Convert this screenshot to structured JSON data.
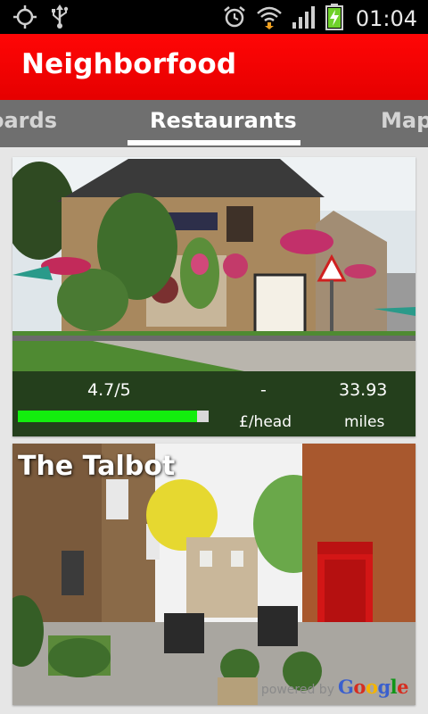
{
  "status_bar": {
    "time": "01:04",
    "icons": [
      "gps-icon",
      "usb-icon",
      "alarm-icon",
      "wifi-icon",
      "signal-icon",
      "battery-charging-icon"
    ]
  },
  "app": {
    "title": "Neighborfood",
    "accent_color": "#ff0000"
  },
  "tabs": [
    {
      "label": "Leaderboards",
      "shown_text": "oards",
      "selected": false
    },
    {
      "label": "Restaurants",
      "shown_text": "Restaurants",
      "selected": true
    },
    {
      "label": "Map",
      "shown_text": "Map",
      "selected": false
    }
  ],
  "cards": [
    {
      "name": "",
      "rating": "4.7/5",
      "rating_fraction": 0.94,
      "price": "-",
      "price_unit": "£/head",
      "distance": "33.93",
      "distance_unit": "miles"
    },
    {
      "name": "The Talbot"
    }
  ],
  "attribution": {
    "text": "powered by",
    "logo_letters": [
      "G",
      "o",
      "o",
      "g",
      "l",
      "e"
    ],
    "logo_colors": [
      "#3a5fcd",
      "#d62d20",
      "#f4b400",
      "#3a5fcd",
      "#109618",
      "#d62d20"
    ]
  }
}
